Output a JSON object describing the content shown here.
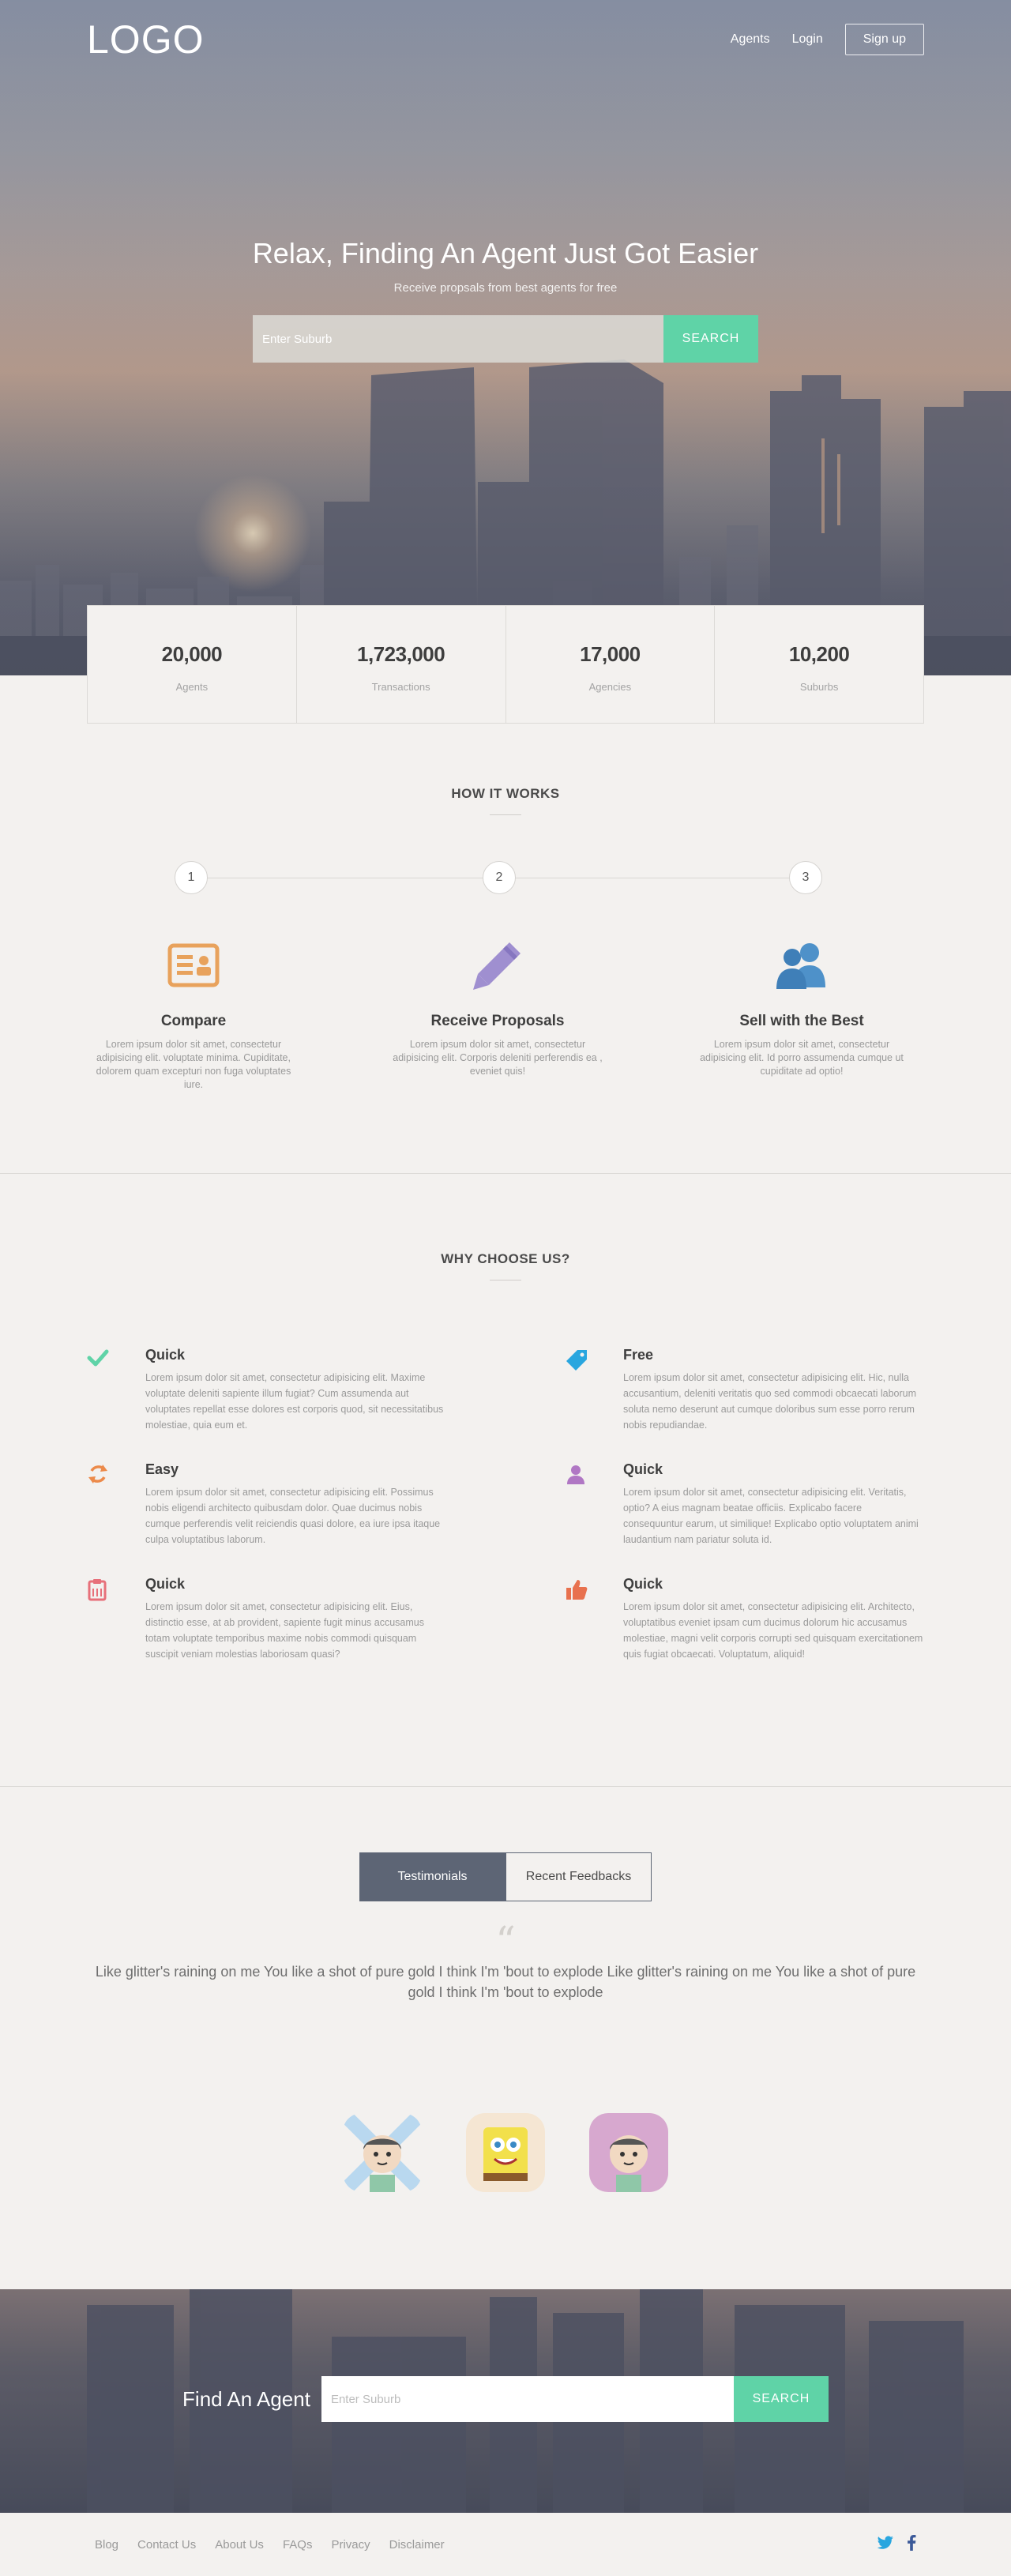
{
  "nav": {
    "logo": "LOGO",
    "links": [
      "Agents",
      "Login"
    ],
    "signup": "Sign up"
  },
  "hero": {
    "title": "Relax, Finding An Agent Just Got Easier",
    "subtitle": "Receive propsals from best agents for free",
    "search_placeholder": "Enter Suburb",
    "search_button": "SEARCH"
  },
  "stats": [
    {
      "value": "20,000",
      "label": "Agents"
    },
    {
      "value": "1,723,000",
      "label": "Transactions"
    },
    {
      "value": "17,000",
      "label": "Agencies"
    },
    {
      "value": "10,200",
      "label": "Suburbs"
    }
  ],
  "how": {
    "title": "HOW IT WORKS",
    "steps": [
      "1",
      "2",
      "3"
    ],
    "features": [
      {
        "icon": "id-card-icon",
        "color": "#e8a25c",
        "title": "Compare",
        "text": "Lorem ipsum dolor sit amet, consectetur adipisicing elit. voluptate minima. Cupiditate, dolorem quam excepturi non fuga voluptates iure."
      },
      {
        "icon": "pencil-icon",
        "color": "#9f8fd0",
        "title": "Receive Proposals",
        "text": "Lorem ipsum dolor sit amet, consectetur adipisicing elit. Corporis deleniti perferendis ea , eveniet quis!"
      },
      {
        "icon": "users-icon",
        "color": "#4e91c9",
        "title": "Sell with the Best",
        "text": "Lorem ipsum dolor sit amet, consectetur adipisicing elit. Id porro assumenda cumque ut cupiditate ad optio!"
      }
    ]
  },
  "why": {
    "title": "WHY CHOOSE US?",
    "items": [
      {
        "icon": "check-icon",
        "color": "#5fd3a7",
        "title": "Quick",
        "text": "Lorem ipsum dolor sit amet, consectetur adipisicing elit. Maxime voluptate deleniti sapiente illum fugiat? Cum assumenda aut voluptates repellat esse dolores est corporis quod, sit necessitatibus molestiae, quia eum et."
      },
      {
        "icon": "tag-icon",
        "color": "#29a6df",
        "title": "Free",
        "text": "Lorem ipsum dolor sit amet, consectetur adipisicing elit. Hic, nulla accusantium, deleniti veritatis quo sed commodi obcaecati laborum soluta nemo deserunt aut cumque doloribus sum esse porro rerum nobis repudiandae."
      },
      {
        "icon": "refresh-icon",
        "color": "#ec8a4a",
        "title": "Easy",
        "text": "Lorem ipsum dolor sit amet, consectetur adipisicing elit. Possimus nobis eligendi architecto quibusdam dolor. Quae ducimus nobis cumque perferendis velit reiciendis quasi dolore, ea iure ipsa itaque culpa voluptatibus laborum."
      },
      {
        "icon": "user-icon",
        "color": "#b077c4",
        "title": "Quick",
        "text": "Lorem ipsum dolor sit amet, consectetur adipisicing elit. Veritatis, optio? A eius magnam beatae officiis. Explicabo facere consequuntur earum, ut similique! Explicabo optio voluptatem animi laudantium nam pariatur soluta id."
      },
      {
        "icon": "clipboard-icon",
        "color": "#e7707a",
        "title": "Quick",
        "text": "Lorem ipsum dolor sit amet, consectetur adipisicing elit. Eius, distinctio esse, at ab provident, sapiente fugit minus accusamus totam voluptate temporibus maxime nobis commodi quisquam suscipit veniam molestias laboriosam quasi?"
      },
      {
        "icon": "thumbs-up-icon",
        "color": "#e8714e",
        "title": "Quick",
        "text": "Lorem ipsum dolor sit amet, consectetur adipisicing elit. Architecto, voluptatibus eveniet ipsam cum ducimus dolorum hic accusamus molestiae, magni velit corporis corrupti sed quisquam exercitationem quis fugiat obcaecati. Voluptatum, aliquid!"
      }
    ]
  },
  "testimonials": {
    "tabs": [
      "Testimonials",
      "Recent Feedbacks"
    ],
    "quote_mark": "“",
    "quote": "Like glitter's raining on me You like a shot of pure gold I think I'm 'bout to explode Like glitter's raining on me You like a shot of pure gold I think I'm 'bout to explode"
  },
  "find": {
    "label": "Find An Agent",
    "search_placeholder": "Enter Suburb",
    "search_button": "SEARCH"
  },
  "footer": {
    "links": [
      "Blog",
      "Contact Us",
      "About Us",
      "FAQs",
      "Privacy",
      "Disclaimer"
    ],
    "social": [
      "twitter-icon",
      "facebook-icon"
    ]
  }
}
